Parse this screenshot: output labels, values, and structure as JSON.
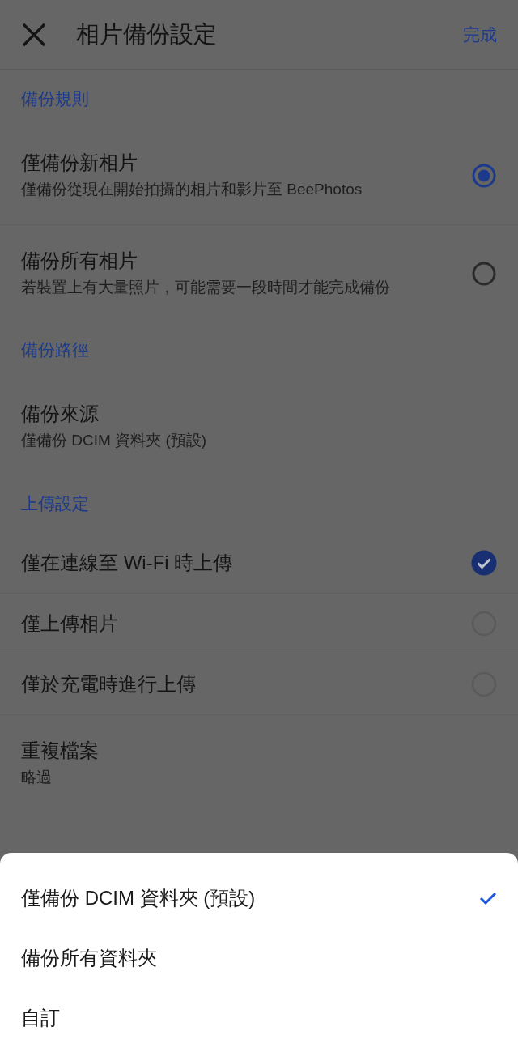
{
  "header": {
    "title": "相片備份設定",
    "done": "完成"
  },
  "sections": [
    {
      "title": "備份規則",
      "items": [
        {
          "kind": "radio",
          "title": "僅備份新相片",
          "subtitle": "僅備份從現在開始拍攝的相片和影片至 BeePhotos",
          "selected": true
        },
        {
          "kind": "radio",
          "title": "備份所有相片",
          "subtitle": "若裝置上有大量照片，可能需要一段時間才能完成備份",
          "selected": false
        }
      ]
    },
    {
      "title": "備份路徑",
      "items": [
        {
          "kind": "info",
          "title": "備份來源",
          "subtitle": "僅備份 DCIM 資料夾 (預設)"
        }
      ]
    },
    {
      "title": "上傳設定",
      "items": [
        {
          "kind": "checkbox",
          "title": "僅在連線至 Wi-Fi 時上傳",
          "checked": true
        },
        {
          "kind": "checkbox",
          "title": "僅上傳相片",
          "checked": false
        },
        {
          "kind": "checkbox",
          "title": "僅於充電時進行上傳",
          "checked": false
        },
        {
          "kind": "info",
          "title": "重複檔案",
          "subtitle": "略過"
        }
      ]
    }
  ],
  "sheet": {
    "options": [
      {
        "label": "僅備份 DCIM 資料夾 (預設)",
        "selected": true
      },
      {
        "label": "備份所有資料夾",
        "selected": false
      },
      {
        "label": "自訂",
        "selected": false
      }
    ]
  }
}
